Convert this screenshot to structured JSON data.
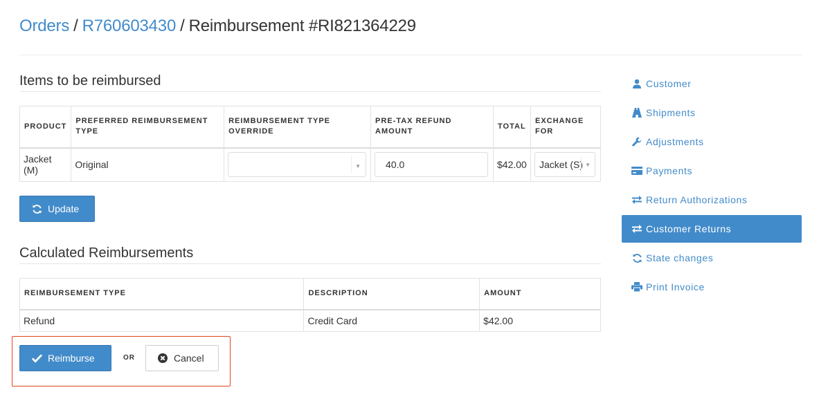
{
  "breadcrumb": {
    "orders": "Orders",
    "order_number": "R760603430",
    "current": "Reimbursement #RI821364229",
    "separator": "/"
  },
  "items_section": {
    "title": "Items to be reimbursed",
    "columns": [
      "Product",
      "Preferred Reimbursement Type",
      "Reimbursement Type Override",
      "Pre-Tax Refund Amount",
      "Total",
      "Exchange For"
    ],
    "rows": [
      {
        "product": "Jacket (M)",
        "preferred_type": "Original",
        "override_value": "",
        "refund_amount": "40.0",
        "total": "$42.00",
        "exchange_for": "Jacket (S)"
      }
    ],
    "update_button": "Update"
  },
  "calculated_section": {
    "title": "Calculated Reimbursements",
    "columns": [
      "Reimbursement Type",
      "Description",
      "Amount"
    ],
    "rows": [
      {
        "type": "Refund",
        "description": "Credit Card",
        "amount": "$42.00"
      }
    ]
  },
  "actions": {
    "reimburse_button": "Reimburse",
    "or_label": "OR",
    "cancel_button": "Cancel"
  },
  "sidebar": {
    "items": [
      {
        "label": "Customer",
        "icon": "user-icon",
        "active": false
      },
      {
        "label": "Shipments",
        "icon": "road-icon",
        "active": false
      },
      {
        "label": "Adjustments",
        "icon": "wrench-icon",
        "active": false
      },
      {
        "label": "Payments",
        "icon": "credit-card-icon",
        "active": false
      },
      {
        "label": "Return Authorizations",
        "icon": "transfer-icon",
        "active": false
      },
      {
        "label": "Customer Returns",
        "icon": "transfer-icon",
        "active": true
      },
      {
        "label": "State changes",
        "icon": "refresh-icon",
        "active": false
      },
      {
        "label": "Print Invoice",
        "icon": "print-icon",
        "active": false
      }
    ]
  },
  "colors": {
    "link": "#428bca",
    "primary_button": "#428bca",
    "highlight_border": "#e0451f"
  }
}
